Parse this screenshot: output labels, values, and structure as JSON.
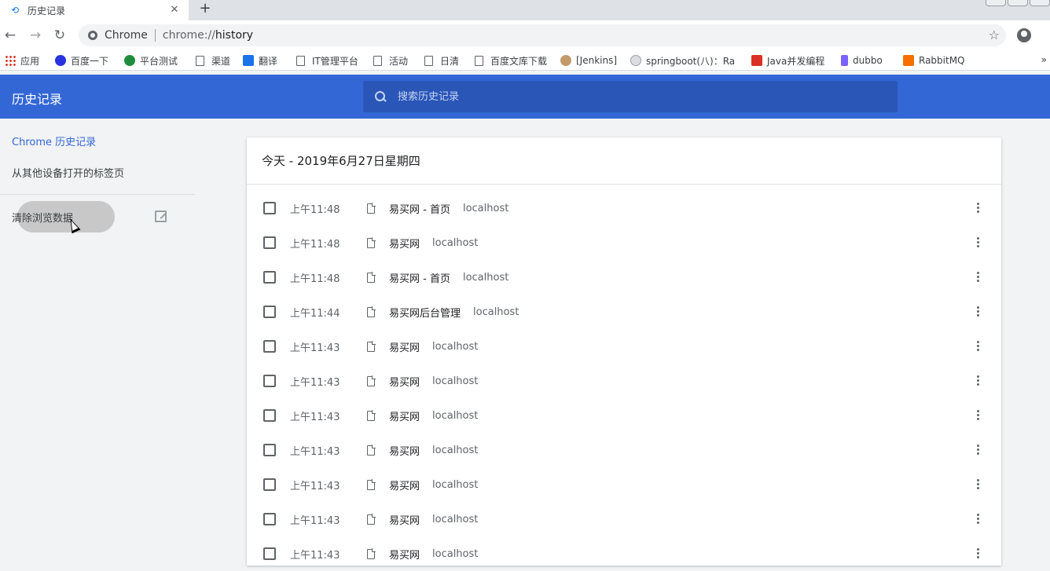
{
  "tab": {
    "title": "历史记录",
    "close": "✕",
    "new_tab": "+"
  },
  "toolbar": {
    "back": "←",
    "forward": "→",
    "reload": "↻",
    "omnibox_label": "Chrome",
    "url_scheme": "chrome://",
    "url_host": "history",
    "star": "☆",
    "menu": "⋮"
  },
  "bookmarks": [
    {
      "label": "应用",
      "icon": "apps-icon",
      "color": "#d93025"
    },
    {
      "label": "百度一下",
      "icon": "baidu-icon",
      "color": "#2932e1"
    },
    {
      "label": "平台测试",
      "icon": "globe-icon",
      "color": "#1e8e3e"
    },
    {
      "label": "渠道",
      "icon": "page-icon"
    },
    {
      "label": "翻译",
      "icon": "translate-icon",
      "color": "#1a73e8"
    },
    {
      "label": "IT管理平台",
      "icon": "page-icon"
    },
    {
      "label": "活动",
      "icon": "page-icon"
    },
    {
      "label": "日清",
      "icon": "page-icon"
    },
    {
      "label": "百度文库下载",
      "icon": "page-icon"
    },
    {
      "label": "[Jenkins]",
      "icon": "jenkins-icon",
      "color": "#c49a6c"
    },
    {
      "label": "springboot(八)：Ra",
      "icon": "db-icon",
      "color": "#9aa0a6"
    },
    {
      "label": "Java并发编程",
      "icon": "csdn-icon",
      "color": "#d93025"
    },
    {
      "label": "dubbo",
      "icon": "dubbo-icon",
      "color": "#7b61ff"
    },
    {
      "label": "RabbitMQ",
      "icon": "rabbitmq-icon",
      "color": "#f76f00"
    }
  ],
  "bookmarks_more": "»",
  "header": {
    "title": "历史记录",
    "search_placeholder": "搜索历史记录"
  },
  "sidebar": {
    "items": [
      {
        "label": "Chrome 历史记录"
      },
      {
        "label": "从其他设备打开的标签页"
      },
      {
        "label": "清除浏览数据"
      }
    ]
  },
  "card": {
    "date_header": "今天 - 2019年6月27日星期四",
    "rows": [
      {
        "time": "上午11:48",
        "title": "易买网 - 首页",
        "domain": "localhost"
      },
      {
        "time": "上午11:48",
        "title": "易买网",
        "domain": "localhost"
      },
      {
        "time": "上午11:48",
        "title": "易买网 - 首页",
        "domain": "localhost"
      },
      {
        "time": "上午11:44",
        "title": "易买网后台管理",
        "domain": "localhost"
      },
      {
        "time": "上午11:43",
        "title": "易买网",
        "domain": "localhost"
      },
      {
        "time": "上午11:43",
        "title": "易买网",
        "domain": "localhost"
      },
      {
        "time": "上午11:43",
        "title": "易买网",
        "domain": "localhost"
      },
      {
        "time": "上午11:43",
        "title": "易买网",
        "domain": "localhost"
      },
      {
        "time": "上午11:43",
        "title": "易买网",
        "domain": "localhost"
      },
      {
        "time": "上午11:43",
        "title": "易买网",
        "domain": "localhost"
      },
      {
        "time": "上午11:43",
        "title": "易买网",
        "domain": "localhost"
      }
    ]
  },
  "colors": {
    "header_blue": "#3367d6",
    "search_blue": "#2a56b8",
    "link_blue": "#3367d6"
  }
}
